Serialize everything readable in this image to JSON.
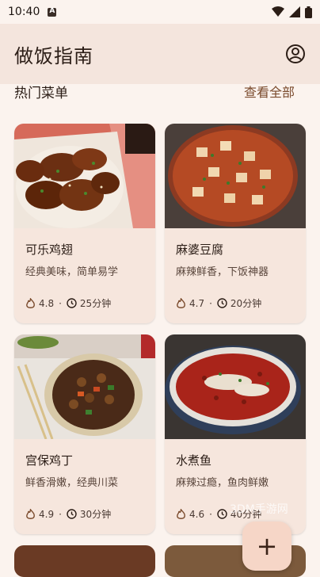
{
  "status": {
    "time": "10:40"
  },
  "appbar": {
    "title": "做饭指南"
  },
  "section": {
    "title": "热门菜单",
    "see_all": "查看全部"
  },
  "recipes": [
    {
      "name": "可乐鸡翅",
      "desc": "经典美味，简单易学",
      "rating": "4.8",
      "time": "25分钟"
    },
    {
      "name": "麻婆豆腐",
      "desc": "麻辣鲜香，下饭神器",
      "rating": "4.7",
      "time": "20分钟"
    },
    {
      "name": "宫保鸡丁",
      "desc": "鲜香滑嫩，经典川菜",
      "rating": "4.9",
      "time": "30分钟"
    },
    {
      "name": "水煮鱼",
      "desc": "麻辣过瘾，鱼肉鲜嫩",
      "rating": "4.6",
      "time": "40分钟"
    }
  ],
  "fab": {
    "label": "+"
  },
  "watermark": "3DM手游网",
  "colors": {
    "background": "#fbf3ee",
    "appbar": "#f4e5dd",
    "card": "#f6e6dd",
    "fab": "#f6d6c7",
    "accent": "#7a4a2c"
  }
}
